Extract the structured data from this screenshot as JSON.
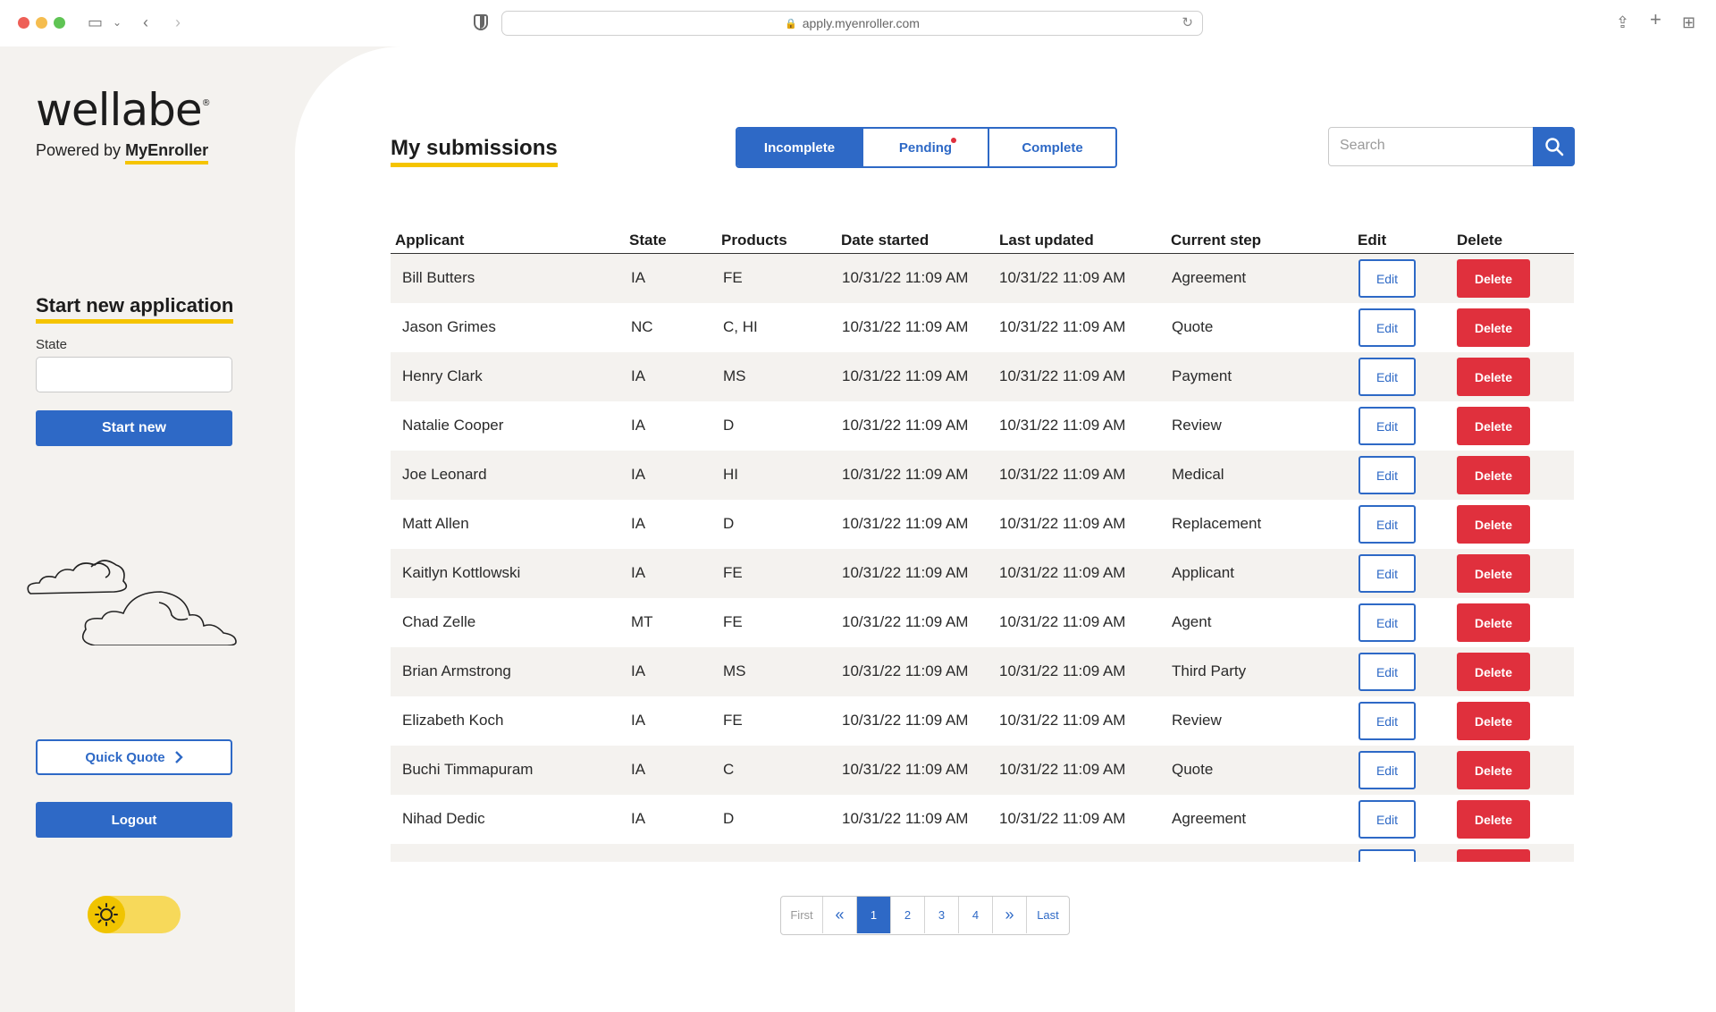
{
  "browser": {
    "url": "apply.myenroller.com"
  },
  "sidebar": {
    "logo_text": "wellabe",
    "powered_prefix": "Powered by",
    "powered_brand": "MyEnroller",
    "start_heading": "Start new application",
    "state_label": "State",
    "state_value": "",
    "start_button": "Start new",
    "quick_quote_button": "Quick Quote",
    "logout_button": "Logout",
    "theme_toggle": "light"
  },
  "main": {
    "title": "My submissions",
    "tabs": [
      {
        "label": "Incomplete",
        "active": true
      },
      {
        "label": "Pending",
        "active": false,
        "notification": true
      },
      {
        "label": "Complete",
        "active": false
      }
    ],
    "search_placeholder": "Search",
    "columns": [
      "Applicant",
      "State",
      "Products",
      "Date started",
      "Last updated",
      "Current step",
      "Edit",
      "Delete"
    ],
    "edit_label": "Edit",
    "delete_label": "Delete",
    "rows": [
      {
        "applicant": "Bill Butters",
        "state": "IA",
        "products": "FE",
        "date_started": "10/31/22 11:09 AM",
        "last_updated": "10/31/22 11:09 AM",
        "step": "Agreement"
      },
      {
        "applicant": "Jason Grimes",
        "state": "NC",
        "products": "C, HI",
        "date_started": "10/31/22 11:09 AM",
        "last_updated": "10/31/22 11:09 AM",
        "step": "Quote"
      },
      {
        "applicant": "Henry Clark",
        "state": "IA",
        "products": "MS",
        "date_started": "10/31/22 11:09 AM",
        "last_updated": "10/31/22 11:09 AM",
        "step": "Payment"
      },
      {
        "applicant": "Natalie Cooper",
        "state": "IA",
        "products": "D",
        "date_started": "10/31/22 11:09 AM",
        "last_updated": "10/31/22 11:09 AM",
        "step": "Review"
      },
      {
        "applicant": "Joe Leonard",
        "state": "IA",
        "products": "HI",
        "date_started": "10/31/22 11:09 AM",
        "last_updated": "10/31/22 11:09 AM",
        "step": "Medical"
      },
      {
        "applicant": "Matt Allen",
        "state": "IA",
        "products": "D",
        "date_started": "10/31/22 11:09 AM",
        "last_updated": "10/31/22 11:09 AM",
        "step": "Replacement"
      },
      {
        "applicant": "Kaitlyn Kottlowski",
        "state": "IA",
        "products": "FE",
        "date_started": "10/31/22 11:09 AM",
        "last_updated": "10/31/22 11:09 AM",
        "step": "Applicant"
      },
      {
        "applicant": "Chad Zelle",
        "state": "MT",
        "products": "FE",
        "date_started": "10/31/22 11:09 AM",
        "last_updated": "10/31/22 11:09 AM",
        "step": "Agent"
      },
      {
        "applicant": "Brian Armstrong",
        "state": "IA",
        "products": "MS",
        "date_started": "10/31/22 11:09 AM",
        "last_updated": "10/31/22 11:09 AM",
        "step": "Third Party"
      },
      {
        "applicant": "Elizabeth Koch",
        "state": "IA",
        "products": "FE",
        "date_started": "10/31/22 11:09 AM",
        "last_updated": "10/31/22 11:09 AM",
        "step": "Review"
      },
      {
        "applicant": "Buchi Timmapuram",
        "state": "IA",
        "products": "C",
        "date_started": "10/31/22 11:09 AM",
        "last_updated": "10/31/22 11:09 AM",
        "step": "Quote"
      },
      {
        "applicant": "Nihad Dedic",
        "state": "IA",
        "products": "D",
        "date_started": "10/31/22 11:09 AM",
        "last_updated": "10/31/22 11:09 AM",
        "step": "Agreement"
      },
      {
        "applicant": "",
        "state": "",
        "products": "",
        "date_started": "",
        "last_updated": "",
        "step": ""
      }
    ],
    "pagination": {
      "first": "First",
      "prev": "«",
      "pages": [
        "1",
        "2",
        "3",
        "4"
      ],
      "current": "1",
      "next": "»",
      "last": "Last"
    }
  },
  "colors": {
    "primary": "#2e69c6",
    "danger": "#e0303d",
    "accent": "#f5c400"
  }
}
